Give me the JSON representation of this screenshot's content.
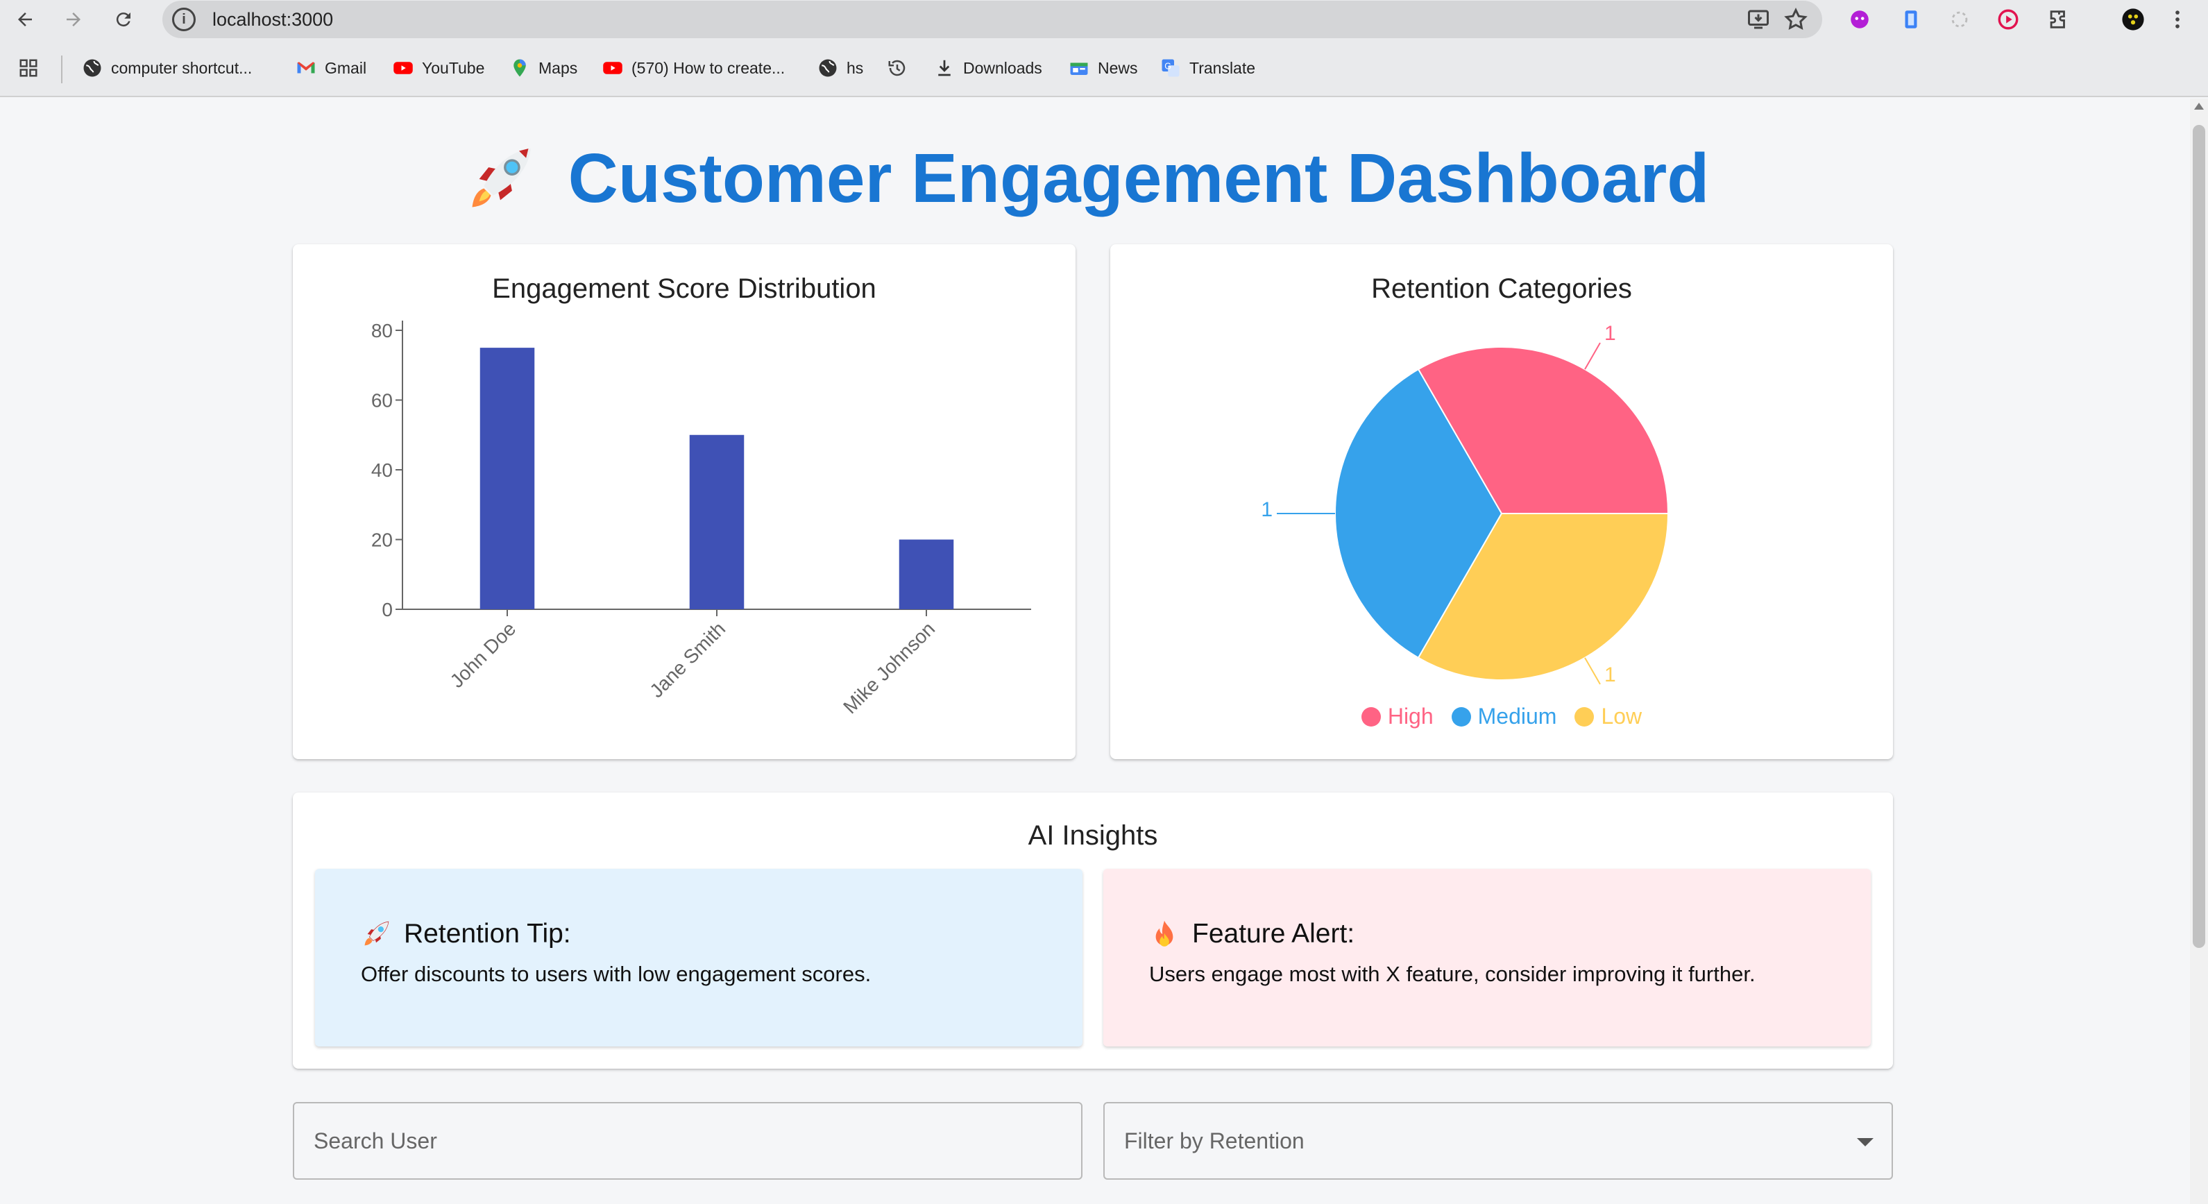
{
  "browser": {
    "url": "localhost:3000",
    "bookmarks": [
      {
        "label": "computer shortcut...",
        "icon": "globe-icon"
      },
      {
        "label": "Gmail",
        "icon": "gmail-icon"
      },
      {
        "label": "YouTube",
        "icon": "youtube-icon"
      },
      {
        "label": "Maps",
        "icon": "maps-icon"
      },
      {
        "label": "(570) How to create...",
        "icon": "youtube-icon"
      },
      {
        "label": "hs",
        "icon": "globe-icon"
      },
      {
        "label": "",
        "icon": "history-icon"
      },
      {
        "label": "Downloads",
        "icon": "download-icon"
      },
      {
        "label": "News",
        "icon": "news-icon"
      },
      {
        "label": "Translate",
        "icon": "translate-icon"
      }
    ]
  },
  "page": {
    "title": "Customer Engagement Dashboard",
    "title_icon": "rocket-icon",
    "accent_color": "#1976d2"
  },
  "bar_card": {
    "title": "Engagement Score Distribution"
  },
  "pie_card": {
    "title": "Retention Categories"
  },
  "chart_data": [
    {
      "type": "bar",
      "categories": [
        "John Doe",
        "Jane Smith",
        "Mike Johnson"
      ],
      "values": [
        75,
        50,
        20
      ],
      "ylim": [
        0,
        80
      ],
      "yticks": [
        0,
        20,
        40,
        60,
        80
      ],
      "color": "#3f51b5",
      "grid": false
    },
    {
      "type": "pie",
      "categories": [
        "High",
        "Medium",
        "Low"
      ],
      "values": [
        1,
        1,
        1
      ],
      "colors": [
        "#ff6384",
        "#36a2eb",
        "#ffce56"
      ],
      "legend_position": "bottom"
    }
  ],
  "insights": {
    "title": "AI Insights",
    "items": [
      {
        "icon": "rocket-icon",
        "title": "Retention Tip:",
        "text": "Offer discounts to users with low engagement scores.",
        "bg": "#e3f2fd"
      },
      {
        "icon": "fire-icon",
        "title": "Feature Alert:",
        "text": "Users engage most with X feature, consider improving it further.",
        "bg": "#ffebee"
      }
    ]
  },
  "filters": {
    "search_label": "Search User",
    "retention_label": "Filter by Retention"
  }
}
